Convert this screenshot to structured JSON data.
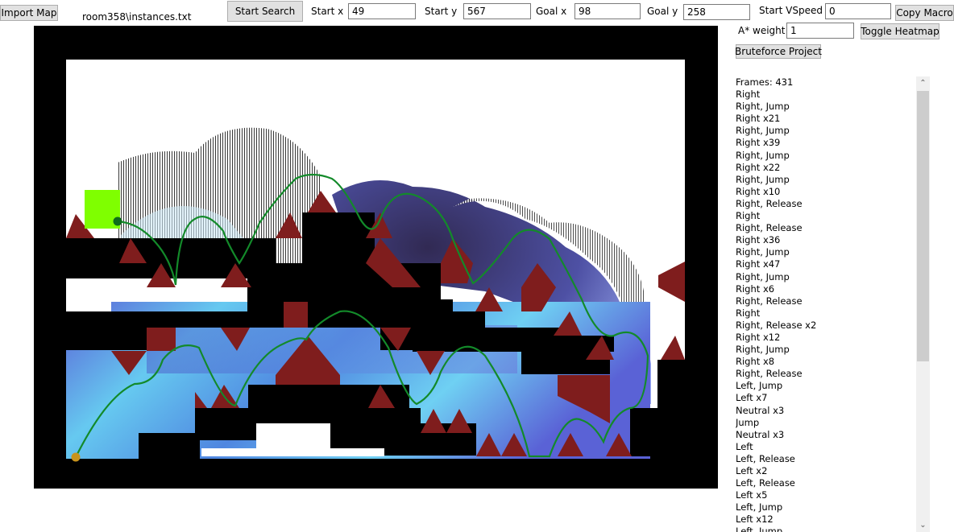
{
  "toolbar": {
    "import_label": "Import Map",
    "file_path": "room358\\instances.txt",
    "start_search_label": "Start Search",
    "start_x_label": "Start x",
    "start_x_value": "49",
    "start_y_label": "Start y",
    "start_y_value": "567",
    "goal_x_label": "Goal x",
    "goal_x_value": "98",
    "goal_y_label": "Goal y",
    "goal_y_value": "258",
    "start_vspeed_label": "Start VSpeed",
    "start_vspeed_value": "0",
    "copy_macro_label": "Copy Macro",
    "astar_weight_label": "A* weight",
    "astar_weight_value": "1",
    "toggle_heatmap_label": "Toggle Heatmap",
    "bruteforce_label": "Bruteforce Project"
  },
  "macro": {
    "frames_text": "Frames: 431",
    "lines": [
      "Right",
      "Right, Jump",
      "Right x21",
      "Right, Jump",
      "Right x39",
      "Right, Jump",
      "Right x22",
      "Right, Jump",
      "Right x10",
      "Right, Release",
      "Right",
      "Right, Release",
      "Right x36",
      "Right, Jump",
      "Right x47",
      "Right, Jump",
      "Right x6",
      "Right, Release",
      "Right",
      "Right, Release x2",
      "Right x12",
      "Right, Jump",
      "Right x8",
      "Right, Release",
      "Left, Jump",
      "Left x7",
      "Neutral x3",
      "Jump",
      "Neutral x3",
      "Left",
      "Left, Release",
      "Left x2",
      "Left, Release",
      "Left x5",
      "Left, Jump",
      "Left x12",
      "Left, Jump"
    ]
  },
  "map": {
    "colors": {
      "wall": "#000000",
      "floor": "#ffffff",
      "spike": "#7f1d1d",
      "goal": "#7fff00",
      "path": "#138a2a",
      "start_marker": "#c8931c",
      "goal_marker": "#0e6b1b",
      "heat_light": "#63c8f0",
      "heat_mid": "#4b7bd8",
      "heat_dark": "#1a1240"
    },
    "icons": [
      "goal-block",
      "start-marker",
      "goal-marker"
    ]
  }
}
